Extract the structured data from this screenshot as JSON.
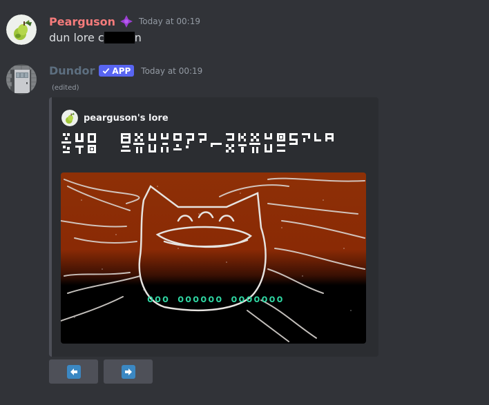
{
  "messages": [
    {
      "username": "Pearguson",
      "username_color": "#f47b7b",
      "role_icon": "purple-diamond-icon",
      "timestamp": "Today at 00:19",
      "text_before": "dun lore c",
      "text_after": "n",
      "avatar": "pear-icon"
    },
    {
      "username": "Dundor",
      "username_color": "#5d6f80",
      "badge": "APP",
      "timestamp": "Today at 00:19",
      "edited": "(edited)",
      "avatar": "door-icon"
    }
  ],
  "embed": {
    "author_name": "pearguson's lore",
    "author_icon": "pear-icon",
    "title_glyph_text": "xyz abcdefg hijklmnop",
    "image": {
      "description": "cat outline drawing with alien caption",
      "caption": "ooo oooooo ooooooo",
      "background_top": "#8e3006",
      "background_bottom": "#000000",
      "caption_color": "#2fd6a2"
    }
  },
  "buttons": [
    {
      "icon": "arrow-left-icon"
    },
    {
      "icon": "arrow-right-icon"
    }
  ],
  "colors": {
    "background": "#313338",
    "embed_background": "#2b2d31",
    "button_background": "#4e5058",
    "app_badge": "#5865f2",
    "arrow_box": "#3b88c3"
  }
}
